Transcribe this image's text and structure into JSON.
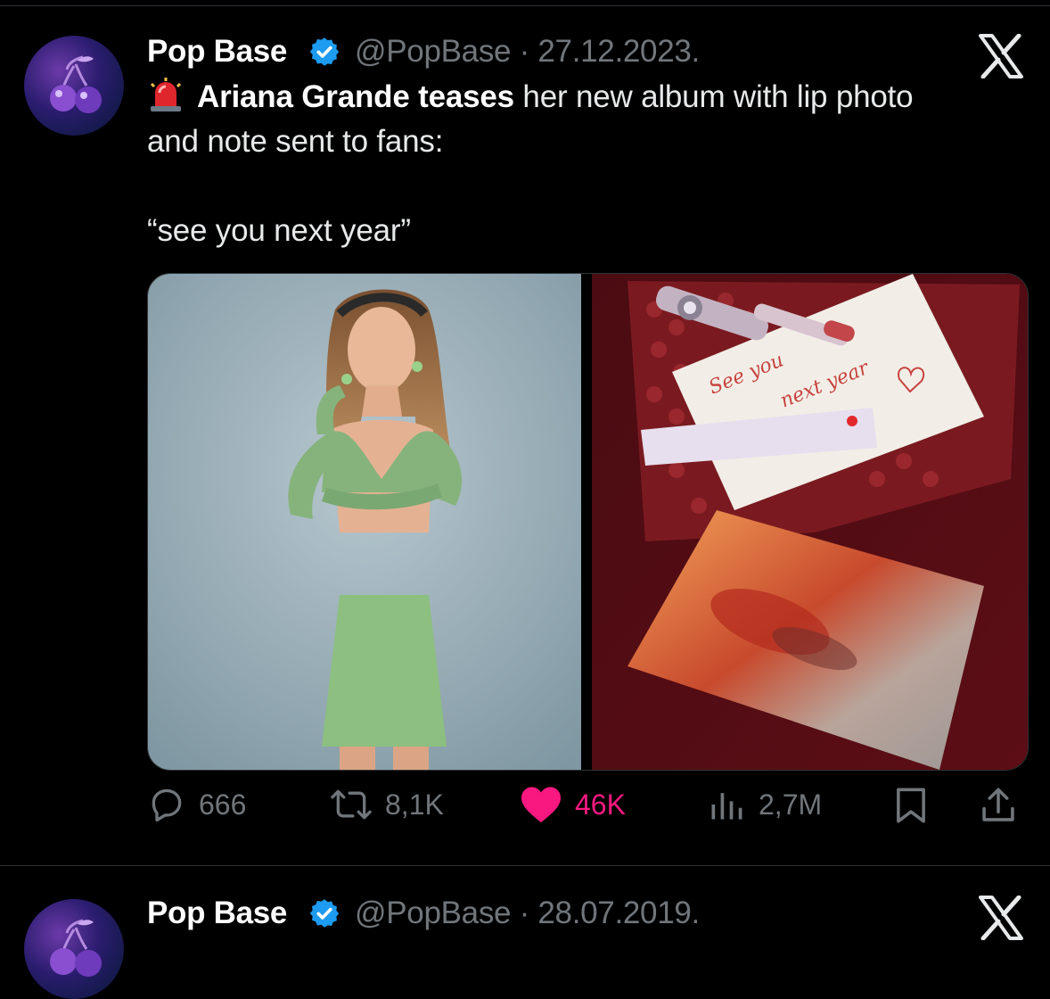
{
  "tweets": [
    {
      "author_name": "Pop Base",
      "handle_date": "@PopBase · 27.12.2023.",
      "text_bold": "Ariana Grande teases",
      "text_rest": " her new album with lip photo and note sent to fans:",
      "quote": "“see you next year”",
      "media": {
        "note_line1": "See you",
        "note_line2": "next year"
      },
      "actions": {
        "replies": "666",
        "retweets": "8,1K",
        "likes": "46K",
        "views": "2,7M"
      }
    },
    {
      "author_name": "Pop Base",
      "handle_date": "@PopBase · 28.07.2019."
    }
  ],
  "icons": {
    "verified": "verified-badge-icon",
    "siren": "police-siren-emoji",
    "x_logo": "x-logo-icon",
    "reply": "speech-bubble-icon",
    "retweet": "retweet-arrows-icon",
    "like": "heart-icon",
    "views": "bar-chart-icon",
    "bookmark": "bookmark-icon",
    "share": "share-upload-icon"
  },
  "colors": {
    "background": "#000000",
    "text": "#e7e9ea",
    "secondary": "#71767b",
    "verified_blue": "#1d9bf0",
    "like_pink": "#f91880"
  }
}
